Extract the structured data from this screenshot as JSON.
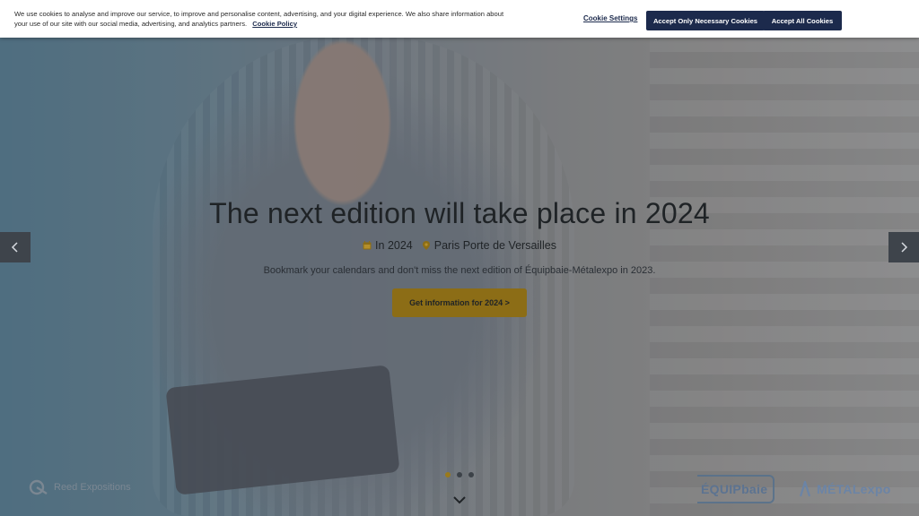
{
  "cookie_banner": {
    "text": "We use cookies to analyse and improve our service, to improve and personalise content, advertising, and your digital experience. We also share information about your use of our site with our social media, advertising, and analytics partners.",
    "policy_link": "Cookie Policy",
    "settings_label": "Cookie Settings",
    "necessary_label": "Accept Only Necessary Cookies",
    "accept_all_label": "Accept All Cookies",
    "colors": {
      "button_bg": "#1c2a4c",
      "bar_bg": "#ffffff"
    }
  },
  "carousel": {
    "title": "The next edition will take place in 2024",
    "meta": {
      "date_icon": "calendar-icon",
      "date_text": "In 2024",
      "location_icon": "location-pin-icon",
      "location_text": "Paris Porte de Versailles"
    },
    "description": "Bookmark your calendars and don't miss the next edition of Équipbaie-Métalexpo in 2023.",
    "cta_label": "Get information for 2024 >",
    "active_slide": 1,
    "slides_total": 3,
    "prev_icon": "chevron-left-icon",
    "next_icon": "chevron-right-icon",
    "scroll_icon": "chevron-down-icon",
    "accent_color": "#9a7a1b"
  },
  "footer": {
    "organizer_logo_text": "Reed Expositions",
    "brand_one": "ÉQUIPbaie",
    "brand_two": "MÉTALexpo"
  }
}
